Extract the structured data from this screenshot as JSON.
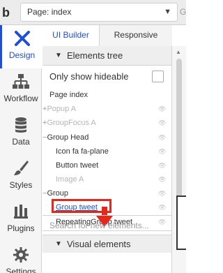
{
  "topbar": {
    "page_selector": "Page: index",
    "right_text": "G"
  },
  "sidebar": {
    "items": [
      {
        "label": "Design",
        "icon": "design-icon",
        "active": true
      },
      {
        "label": "Workflow",
        "icon": "workflow-icon",
        "active": false
      },
      {
        "label": "Data",
        "icon": "database-icon",
        "active": false
      },
      {
        "label": "Styles",
        "icon": "brush-icon",
        "active": false
      },
      {
        "label": "Plugins",
        "icon": "plugin-icon",
        "active": false
      },
      {
        "label": "Settings",
        "icon": "gear-icon",
        "active": false
      }
    ]
  },
  "tabs": [
    {
      "label": "UI Builder",
      "active": true
    },
    {
      "label": "Responsive",
      "active": false
    }
  ],
  "elements_tree": {
    "header": "Elements tree",
    "only_show_hideable": "Only show hideable",
    "rows": [
      {
        "label": "Page index",
        "prefix": "",
        "muted": false
      },
      {
        "label": "Popup A",
        "prefix": "+",
        "muted": true
      },
      {
        "label": "GroupFocus A",
        "prefix": "+",
        "muted": true
      },
      {
        "label": "Group Head",
        "prefix": "−",
        "muted": false
      },
      {
        "label": "Icon fa fa-plane",
        "prefix": "",
        "muted": false
      },
      {
        "label": "Button tweet",
        "prefix": "",
        "muted": false
      },
      {
        "label": "Image A",
        "prefix": "",
        "muted": true
      },
      {
        "label": "Group",
        "prefix": "−",
        "muted": false
      },
      {
        "label": "Group tweet",
        "prefix": "",
        "muted": false
      },
      {
        "label": "RepeatingGroup tweet",
        "prefix": "",
        "muted": false
      }
    ],
    "search_placeholder": "Search for new elements..."
  },
  "visual_elements": {
    "header": "Visual elements"
  },
  "colors": {
    "accent": "#1f4fd6",
    "highlight": "#e8271b"
  }
}
